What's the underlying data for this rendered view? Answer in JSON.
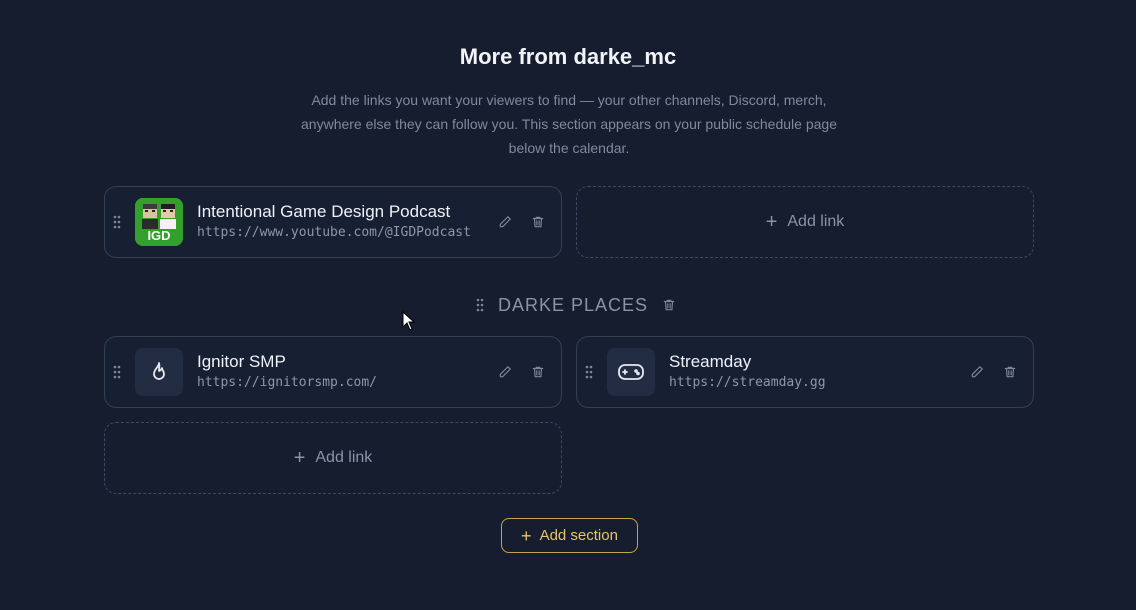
{
  "header": {
    "title": "More from darke_mc",
    "description": "Add the links you want your viewers to find — your other channels, Discord, merch, anywhere else they can follow you. This section appears on your public schedule page below the calendar."
  },
  "sections": [
    {
      "title": "",
      "links": [
        {
          "title": "Intentional Game Design Podcast",
          "url": "https://www.youtube.com/@IGDPodcast",
          "icon": "igd-podcast-logo",
          "logo_text": "IGD"
        }
      ],
      "add_link_label": "Add link"
    },
    {
      "title": "DARKE PLACES",
      "links": [
        {
          "title": "Ignitor SMP",
          "url": "https://ignitorsmp.com/",
          "icon": "flame-icon"
        },
        {
          "title": "Streamday",
          "url": "https://streamday.gg",
          "icon": "gamepad-icon"
        }
      ],
      "add_link_label": "Add link"
    }
  ],
  "add_section_label": "Add section",
  "colors": {
    "background": "#151d2e",
    "card_border": "#344056",
    "accent": "#e9c46a",
    "muted": "#8a94a8"
  }
}
